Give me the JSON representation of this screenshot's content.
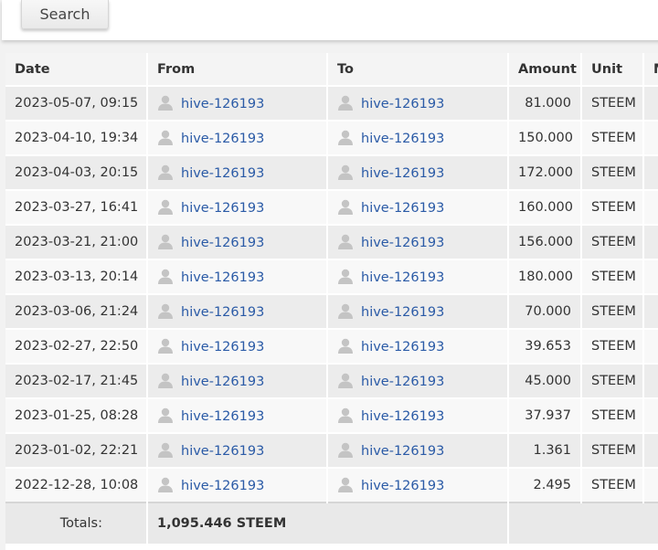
{
  "search": {
    "button_label": "Search"
  },
  "table": {
    "headers": {
      "date": "Date",
      "from": "From",
      "to": "To",
      "amount": "Amount",
      "unit": "Unit",
      "extra": "M"
    },
    "rows": [
      {
        "date": "2023-05-07, 09:15",
        "from": "hive-126193",
        "to": "hive-126193",
        "amount": "81.000",
        "unit": "STEEM"
      },
      {
        "date": "2023-04-10, 19:34",
        "from": "hive-126193",
        "to": "hive-126193",
        "amount": "150.000",
        "unit": "STEEM"
      },
      {
        "date": "2023-04-03, 20:15",
        "from": "hive-126193",
        "to": "hive-126193",
        "amount": "172.000",
        "unit": "STEEM"
      },
      {
        "date": "2023-03-27, 16:41",
        "from": "hive-126193",
        "to": "hive-126193",
        "amount": "160.000",
        "unit": "STEEM"
      },
      {
        "date": "2023-03-21, 21:00",
        "from": "hive-126193",
        "to": "hive-126193",
        "amount": "156.000",
        "unit": "STEEM"
      },
      {
        "date": "2023-03-13, 20:14",
        "from": "hive-126193",
        "to": "hive-126193",
        "amount": "180.000",
        "unit": "STEEM"
      },
      {
        "date": "2023-03-06, 21:24",
        "from": "hive-126193",
        "to": "hive-126193",
        "amount": "70.000",
        "unit": "STEEM"
      },
      {
        "date": "2023-02-27, 22:50",
        "from": "hive-126193",
        "to": "hive-126193",
        "amount": "39.653",
        "unit": "STEEM"
      },
      {
        "date": "2023-02-17, 21:45",
        "from": "hive-126193",
        "to": "hive-126193",
        "amount": "45.000",
        "unit": "STEEM"
      },
      {
        "date": "2023-01-25, 08:28",
        "from": "hive-126193",
        "to": "hive-126193",
        "amount": "37.937",
        "unit": "STEEM"
      },
      {
        "date": "2023-01-02, 22:21",
        "from": "hive-126193",
        "to": "hive-126193",
        "amount": "1.361",
        "unit": "STEEM"
      },
      {
        "date": "2022-12-28, 10:08",
        "from": "hive-126193",
        "to": "hive-126193",
        "amount": "2.495",
        "unit": "STEEM"
      }
    ],
    "totals": {
      "label": "Totals:",
      "value": "1,095.446 STEEM"
    }
  },
  "icons": {
    "account": "user-icon"
  },
  "colors": {
    "link": "#2a5aa6",
    "row_odd": "#ececec",
    "row_even": "#f8f8f8",
    "icon": "#c4c4c4"
  }
}
